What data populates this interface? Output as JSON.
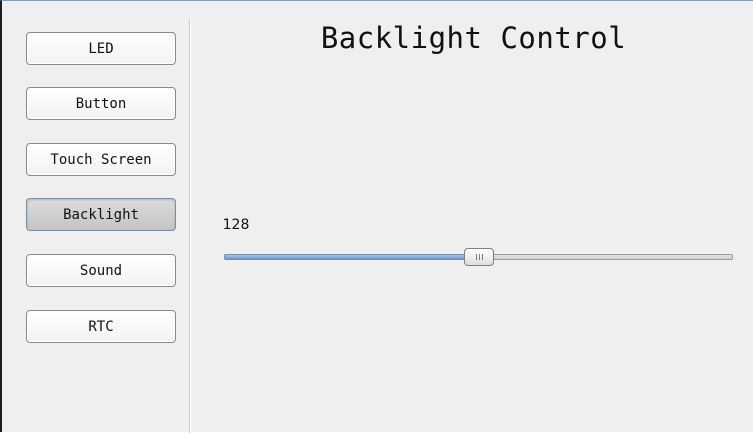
{
  "nav": {
    "items": [
      {
        "label": "LED",
        "active": false
      },
      {
        "label": "Button",
        "active": false
      },
      {
        "label": "Touch Screen",
        "active": false
      },
      {
        "label": "Backlight",
        "active": true
      },
      {
        "label": "Sound",
        "active": false
      },
      {
        "label": "RTC",
        "active": false
      }
    ]
  },
  "main": {
    "title": "Backlight Control"
  },
  "backlight_slider": {
    "value": 128,
    "value_label": "128",
    "min": 0,
    "max": 255
  },
  "colors": {
    "accent": "#6f97c9",
    "active_button": "#c4c4c4",
    "background": "#efefef"
  }
}
